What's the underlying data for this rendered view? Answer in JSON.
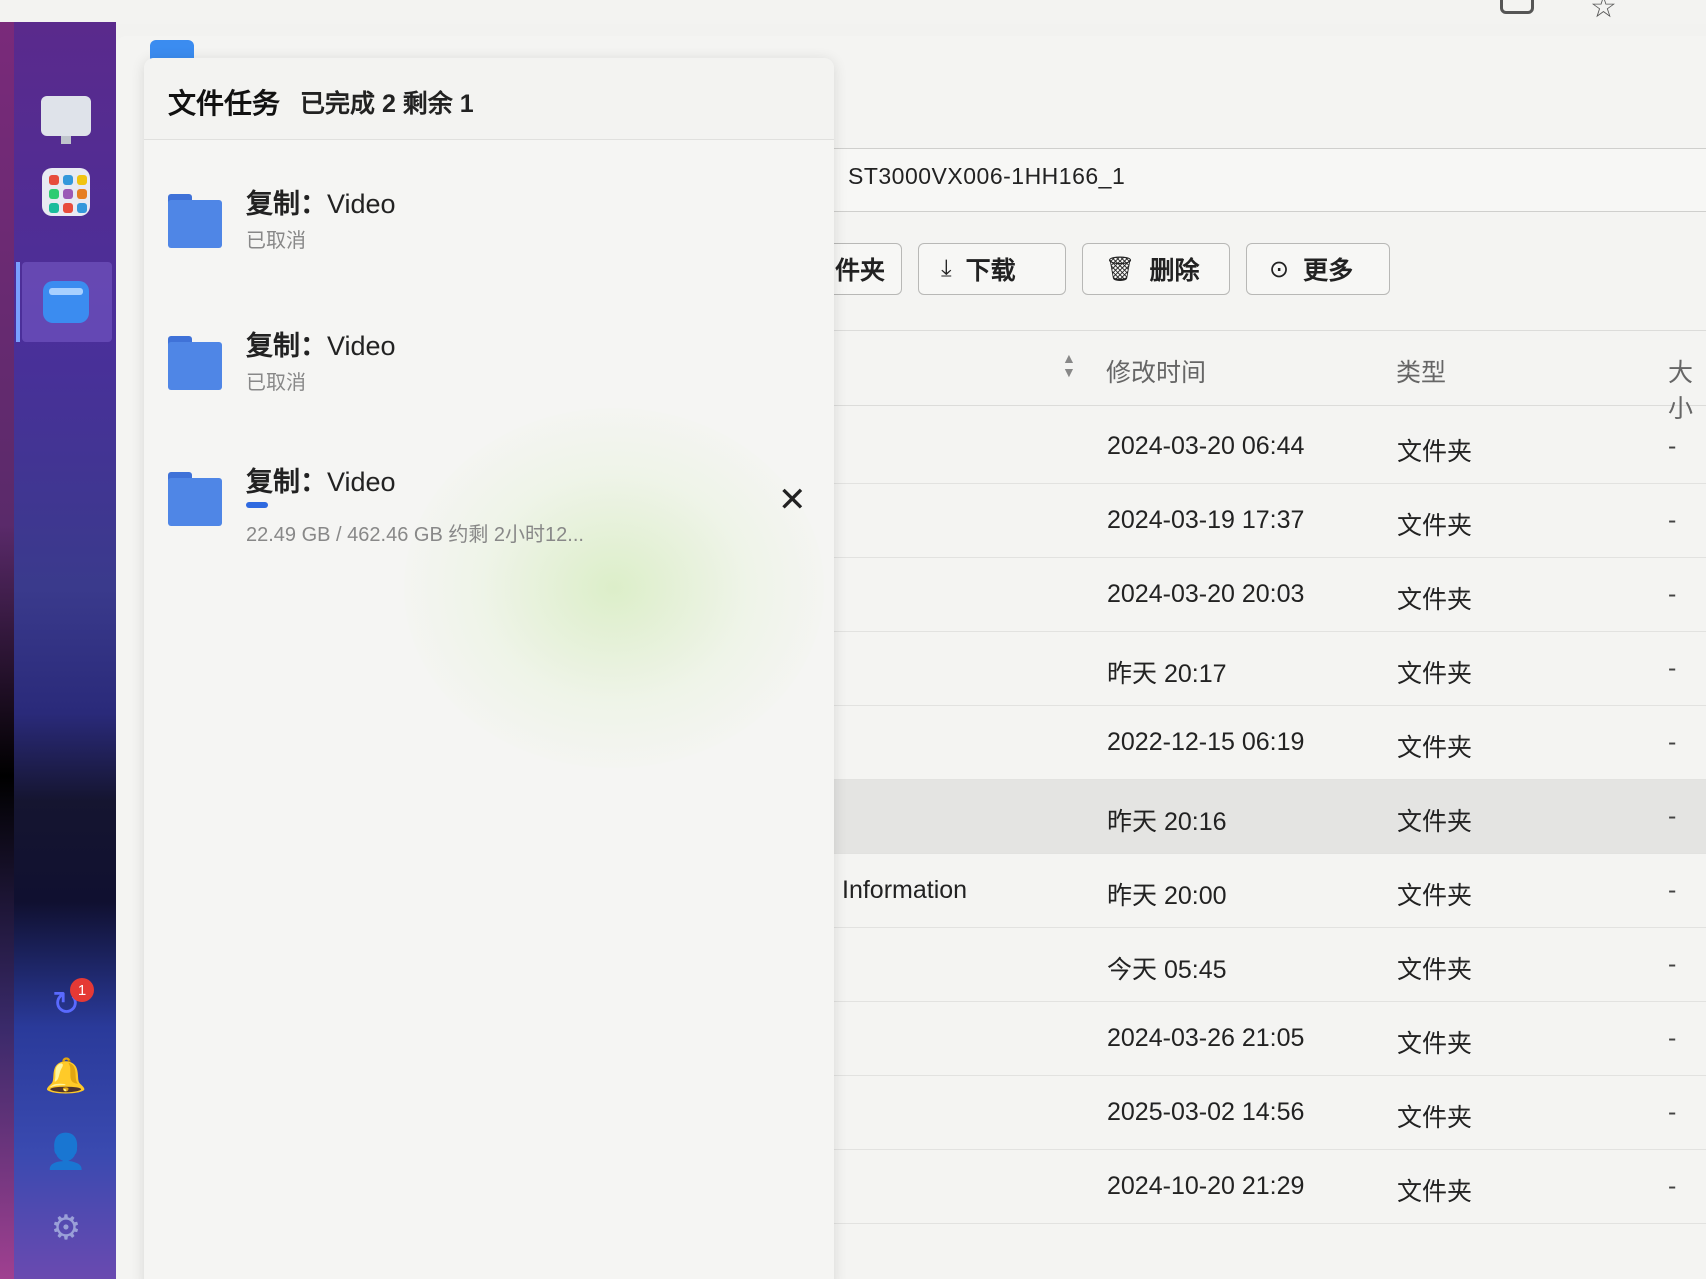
{
  "task_panel": {
    "title": "文件任务",
    "status": "已完成 2 剩余 1",
    "tasks": [
      {
        "title_prefix": "复制：",
        "title_name": "Video",
        "status": "已取消"
      },
      {
        "title_prefix": "复制：",
        "title_name": "Video",
        "status": "已取消"
      },
      {
        "title_prefix": "复制：",
        "title_name": "Video",
        "progress_text": "22.49 GB / 462.46 GB   约剩 2小时12...",
        "progress_fraction": 0.0486,
        "close_label": "✕"
      }
    ]
  },
  "path": {
    "text": "ST3000VX006-1HH166_1"
  },
  "toolbar": {
    "newfolder_partial": "件夹",
    "download": "下载",
    "delete": "删除",
    "more": "更多"
  },
  "table": {
    "headers": {
      "modified": "修改时间",
      "type": "类型",
      "size": "大小"
    },
    "rows": [
      {
        "name": "",
        "time": "2024-03-20 06:44",
        "type": "文件夹",
        "size": "-"
      },
      {
        "name": "",
        "time": "2024-03-19 17:37",
        "type": "文件夹",
        "size": "-"
      },
      {
        "name": "",
        "time": "2024-03-20 20:03",
        "type": "文件夹",
        "size": "-"
      },
      {
        "name": "",
        "time": "昨天 20:17",
        "type": "文件夹",
        "size": "-"
      },
      {
        "name": "",
        "time": "2022-12-15 06:19",
        "type": "文件夹",
        "size": "-"
      },
      {
        "name": "",
        "time": "昨天 20:16",
        "type": "文件夹",
        "size": "-"
      },
      {
        "name": "Information",
        "time": "昨天 20:00",
        "type": "文件夹",
        "size": "-"
      },
      {
        "name": "",
        "time": "今天 05:45",
        "type": "文件夹",
        "size": "-"
      },
      {
        "name": "",
        "time": "2024-03-26 21:05",
        "type": "文件夹",
        "size": "-"
      },
      {
        "name": "",
        "time": "2025-03-02 14:56",
        "type": "文件夹",
        "size": "-"
      },
      {
        "name": "",
        "time": "2024-10-20 21:29",
        "type": "文件夹",
        "size": "-"
      }
    ]
  },
  "dock": {
    "notification_count": "1",
    "icons": [
      "monitor-icon",
      "app-center-icon",
      "file-manager-icon",
      "sync-icon",
      "bell-icon",
      "user-icon",
      "gear-icon"
    ]
  },
  "colors": {
    "accent": "#3b8cf0",
    "badge": "#e53935",
    "folder": "#4f86e6"
  }
}
